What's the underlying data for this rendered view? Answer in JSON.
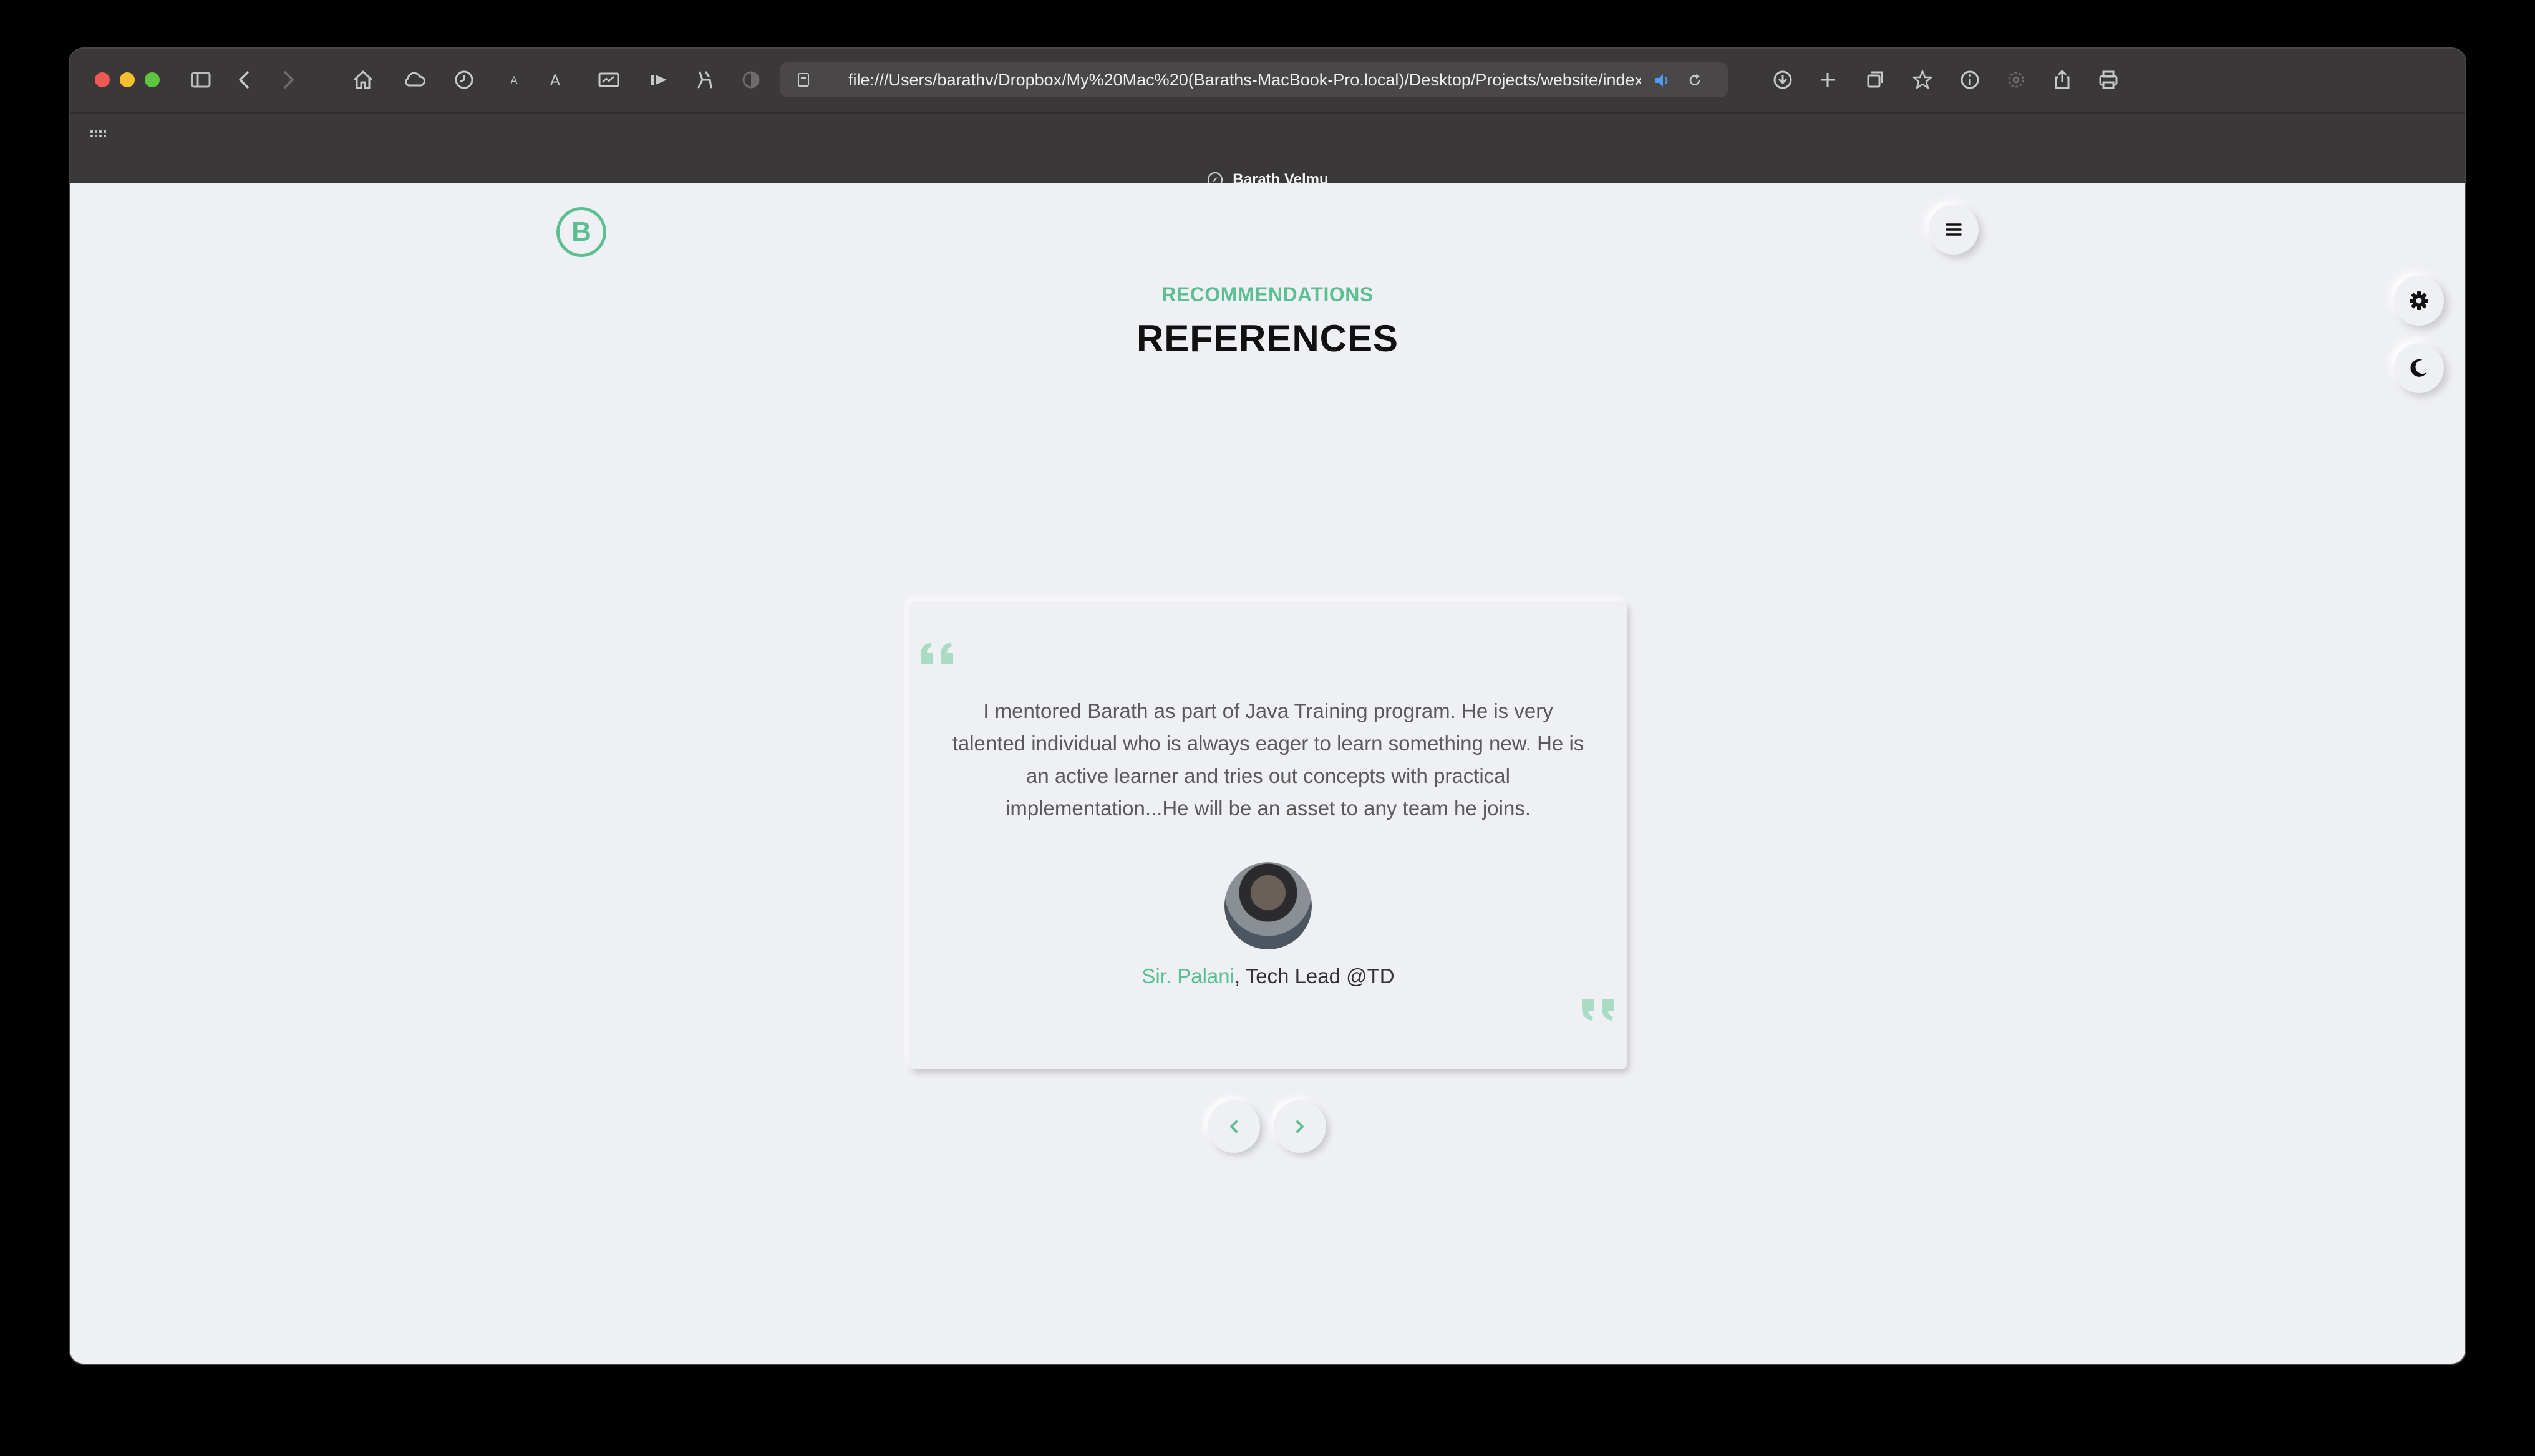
{
  "browser": {
    "url": "file:///Users/barathv/Dropbox/My%20Mac%20(Baraths-MacBook-Pro.local)/Desktop/Projects/website/index.htm",
    "tab_title": "Barath Velmu"
  },
  "page": {
    "logo_letter": "B",
    "section_subtitle": "RECOMMENDATIONS",
    "section_title": "REFERENCES",
    "testimonial": {
      "text": "I mentored Barath as part of Java Training program. He is very talented individual who is always eager to learn something new. He is an active learner and tries out concepts with practical implementation...He will be an asset to any team he joins.",
      "author_name": "Sir. Palani",
      "author_role": ", Tech Lead @TD"
    }
  },
  "colors": {
    "accent": "#5cbf92",
    "background": "#eff0f3",
    "chrome": "#3b3839"
  }
}
